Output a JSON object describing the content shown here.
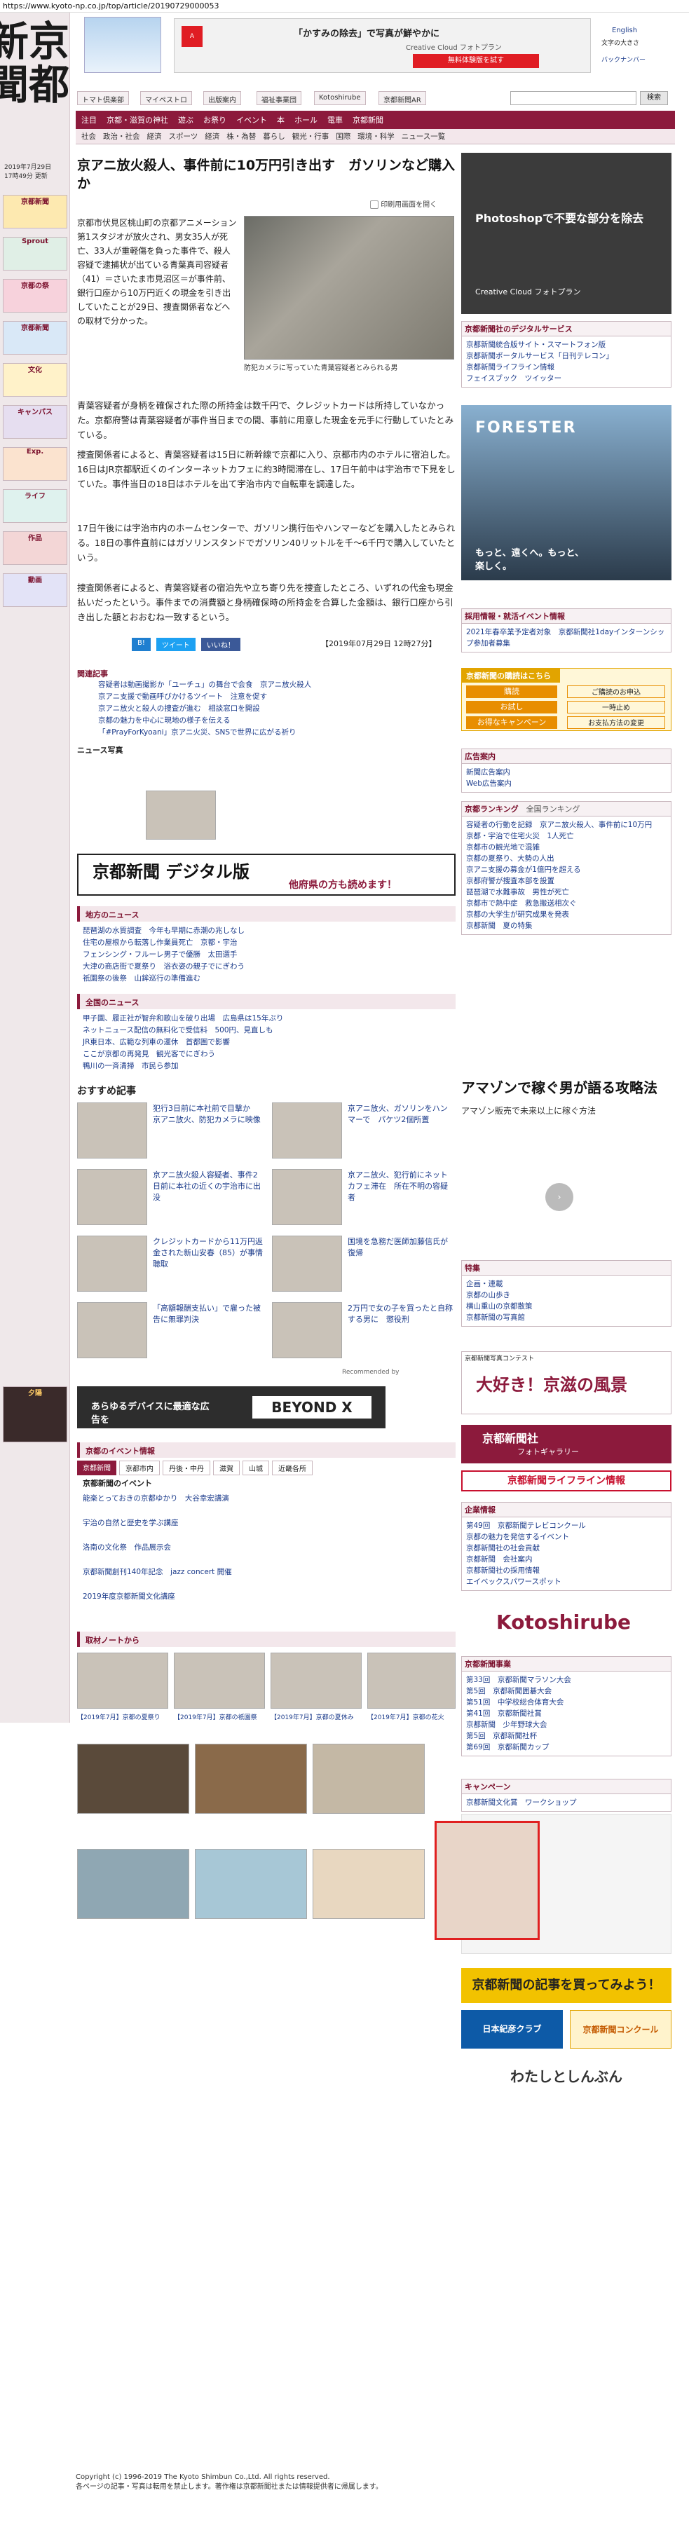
{
  "url": "https://www.kyoto-np.co.jp/top/article/20190729000053",
  "site": {
    "logo": "京都新聞"
  },
  "header": {
    "english": "English",
    "font_size": "文字の大きさ",
    "backnumber": "バックナンバー",
    "search_button": "検索",
    "top_buttons": [
      "トマト倶楽部",
      "マイペストロ",
      "出版案内",
      "福祉事業団",
      "Kotoshirube",
      "京都新聞AR"
    ]
  },
  "ad_top": {
    "text1": "「かすみの除去」で写真が鮮やかに",
    "text2": "Creative Cloud フォトプラン",
    "cta": "無料体験版を試す"
  },
  "nav": {
    "primary": [
      "注目",
      "京都・滋賀の神社",
      "遊ぶ",
      "お祭り",
      "イベント",
      "本",
      "ホール",
      "電車",
      "京都新聞"
    ],
    "secondary": [
      "社会",
      "政治・社会",
      "経済",
      "スポーツ",
      "経済",
      "株・為替",
      "暮らし",
      "観光・行事",
      "国際",
      "環境・科学",
      "ニュース一覧"
    ]
  },
  "article": {
    "title": "京アニ放火殺人、事件前に10万円引き出す　ガソリンなど購入か",
    "print_label": "印刷用画面を開く",
    "caption": "防犯カメラに写っていた青葉容疑者とみられる男",
    "paragraphs": [
      "京都市伏見区桃山町の京都アニメーション第1スタジオが放火され、男女35人が死亡、33人が重軽傷を負った事件で、殺人容疑で逮捕状が出ている青葉真司容疑者（41）＝さいたま市見沼区＝が事件前、銀行口座から10万円近くの現金を引き出していたことが29日、捜査関係者などへの取材で分かった。",
      "青葉容疑者が身柄を確保された際の所持金は数千円で、クレジットカードは所持していなかった。京都府警は青葉容疑者が事件当日までの間、事前に用意した現金を元手に行動していたとみている。",
      "捜査関係者によると、青葉容疑者は15日に新幹線で京都に入り、京都市内のホテルに宿泊した。16日はJR京都駅近くのインターネットカフェに約3時間滞在し、17日午前中は宇治市で下見をしていた。事件当日の18日はホテルを出て宇治市内で自転車を調達した。",
      "17日午後には宇治市内のホームセンターで、ガソリン携行缶やハンマーなどを購入したとみられる。18日の事件直前にはガソリンスタンドでガソリン40リットルを千～6千円で購入していたという。",
      "捜査関係者によると、青葉容疑者の宿泊先や立ち寄り先を捜査したところ、いずれの代金も現金払いだったという。事件までの消費額と身柄確保時の所持金を合算した金額は、銀行口座から引き出した額とおおむね一致するという。"
    ],
    "timestamp": "【2019年07月29日 12時27分】",
    "share": [
      "B!",
      "ツイート",
      "いいね！"
    ]
  },
  "related": {
    "title": "関連記事",
    "items": [
      "容疑者は動画撮影か「ユーチュ」の舞台で会食　京アニ放火殺人",
      "京アニ支援で動画呼びかけるツイート　注意を促す",
      "京アニ放火と殺人の捜査が進む　相談窓口を開設",
      "京都の魅力を中心に現地の様子を伝える",
      "「#PrayForKyoani」京アニ火災、SNSで世界に広がる祈り"
    ],
    "news_photo": "ニュース写真"
  },
  "digital_ad": {
    "title": "京都新聞 デジタル版",
    "sub": "他府県の方も読めます！"
  },
  "local_news": {
    "title": "地方のニュース",
    "items": [
      "琵琶湖の水質調査　今年も早期に赤潮の兆しなし",
      "住宅の屋根から転落し作業員死亡　京都・宇治",
      "フェンシング・フルーレ男子で優勝　太田選手",
      "大津の商店街で夏祭り　浴衣姿の親子でにぎわう",
      "祇園祭の後祭　山鉾巡行の準備進む"
    ]
  },
  "national_news": {
    "title": "全国のニュース",
    "items": [
      "甲子園、履正社が智弁和歌山を破り出場　広島県は15年ぶり",
      "ネットニュース配信の無料化で受信料　500円、見直しも",
      "JR東日本、広範な列車の運休　首都圏で影響",
      "ここが京都の再発見　観光客でにぎわう",
      "鴨川の一斉清掃　市民ら参加"
    ]
  },
  "recommend": {
    "title": "おすすめ記事",
    "items": [
      "犯行3日前に本社前で目撃か　京アニ放火、防犯カメラに映像",
      "京アニ放火、ガソリンをハンマーで　パケツ2個所置",
      "京アニ放火殺人容疑者、事件2日前に本社の近くの宇治市に出没",
      "京アニ放火、犯行前にネットカフェ滞在　所在不明の容疑者",
      "クレジットカードから11万円返金された新山安春（85）が事情聴取",
      "国境を急務だ医師加藤信氏が復帰",
      "「高額報酬支払い」で雇った被告に無罪判決",
      "2万円で女の子を買ったと自称する男に　懲役刑"
    ],
    "credit": "Recommended by"
  },
  "beyond_ad": {
    "text": "あらゆるデバイスに最適な広告を",
    "brand": "BEYOND X"
  },
  "events": {
    "title": "京都のイベント情報",
    "tabs": [
      "京都新聞",
      "京都市内",
      "丹後・中丹",
      "滋賀",
      "山城",
      "近畿各所"
    ],
    "subtitle": "京都新聞のイベント",
    "items": [
      "能楽とっておきの京都ゆかり　大谷幸宏講演",
      "宇治の自然と歴史を学ぶ講座",
      "洛南の文化祭　作品展示会",
      "京都新聞創刊140年記念　jazz concert 開催",
      "2019年度京都新聞文化講座"
    ]
  },
  "sponsored": {
    "title": "取材ノートから",
    "items": [
      "【2019年7月】京都の夏祭り",
      "【2019年7月】京都の祇園祭",
      "【2019年7月】京都の夏休み",
      "【2019年7月】京都の花火"
    ]
  },
  "right": {
    "ad1": {
      "title": "Photoshopで不要な部分を除去",
      "brand": "Creative Cloud フォトプラン"
    },
    "service": {
      "title": "京都新聞社のデジタルサービス",
      "items": [
        "京都新聞統合版サイト・スマートフォン版",
        "京都新聞ポータルサービス「日刊テレコン」",
        "京都新聞ライフライン情報",
        "フェイスブック　ツイッター"
      ]
    },
    "ad2": {
      "brand": "FORESTER",
      "sub": "もっと、遠くへ。もっと、楽しく。"
    },
    "job": {
      "title": "採用情報・就活イベント情報",
      "text": "2021年春卒業予定者対象　京都新聞社1dayインターンシップ参加者募集"
    },
    "subscribe": {
      "title": "京都新聞の購読はこちら",
      "buttons": [
        "購読",
        "お試し",
        "お得なキャンペーン"
      ],
      "sub": [
        "ご購読のお申込",
        "一時止め",
        "お支払方法の変更"
      ]
    },
    "ad_guide": {
      "title": "広告案内",
      "items": [
        "新聞広告案内",
        "Web広告案内"
      ]
    },
    "ranking": {
      "title": "京都ランキング",
      "tabs": [
        "全国ランキング"
      ],
      "items": [
        "容疑者の行動を記録　京アニ放火殺人、事件前に10万円",
        "京都・宇治で住宅火災　1人死亡",
        "京都市の観光地で混雑",
        "京都の夏祭り、大勢の人出",
        "京アニ支援の募金が1億円を超える",
        "京都府警が捜査本部を設置",
        "琵琶湖で水難事故　男性が死亡",
        "京都市で熱中症　救急搬送相次ぐ",
        "京都の大学生が研究成果を発表",
        "京都新聞　夏の特集"
      ]
    },
    "amazon": {
      "title": "アマゾンで稼ぐ男が語る攻略法",
      "sub": "アマゾン販売で未来以上に稼ぐ方法"
    },
    "special": {
      "title": "特集",
      "items": [
        "企画・連載",
        "京都の山歩き",
        "横山重山の京都散策",
        "京都新聞の写真館"
      ]
    },
    "photo_contest": {
      "title": "京都新聞写真コンテスト",
      "text": "大好き！京滋の風景"
    },
    "photo_bank": {
      "title": "京都新聞社",
      "sub": "フォトギャラリー"
    },
    "lifeline": "京都新聞ライフライン情報",
    "corporate": {
      "title": "企業情報",
      "items": [
        "第49回　京都新聞テレビコンクール",
        "京都の魅力を発信するイベント",
        "京都新聞社の社会貢献",
        "京都新聞　会社案内",
        "京都新聞社の採用情報",
        "エイベックスパワースポット"
      ]
    },
    "kotoshirube": "Kotoshirube",
    "events2": {
      "title": "京都新聞事業",
      "items": [
        "第33回　京都新聞マラソン大会",
        "第5回　京都新聞囲碁大会",
        "第51回　中学校総合体育大会",
        "第41回　京都新聞社賞",
        "京都新聞　少年野球大会",
        "第5回　京都新聞社杯",
        "第69回　京都新聞カップ"
      ]
    },
    "campaign": {
      "title": "キャンペーン",
      "items": [
        "京都新聞文化賞　ワークショップ"
      ]
    },
    "buy": "京都新聞の記事を買ってみよう！",
    "club": "日本紀彦クラブ",
    "contest": "京都新聞コンクール",
    "watashi": "わたしとしんぶん"
  },
  "footer": {
    "copyright": "Copyright (c) 1996-2019 The Kyoto Shimbun Co.,Ltd. All rights reserved.",
    "note": "各ページの記事・写真は転用を禁止します。著作権は京都新聞社または情報提供者に帰属します。"
  }
}
